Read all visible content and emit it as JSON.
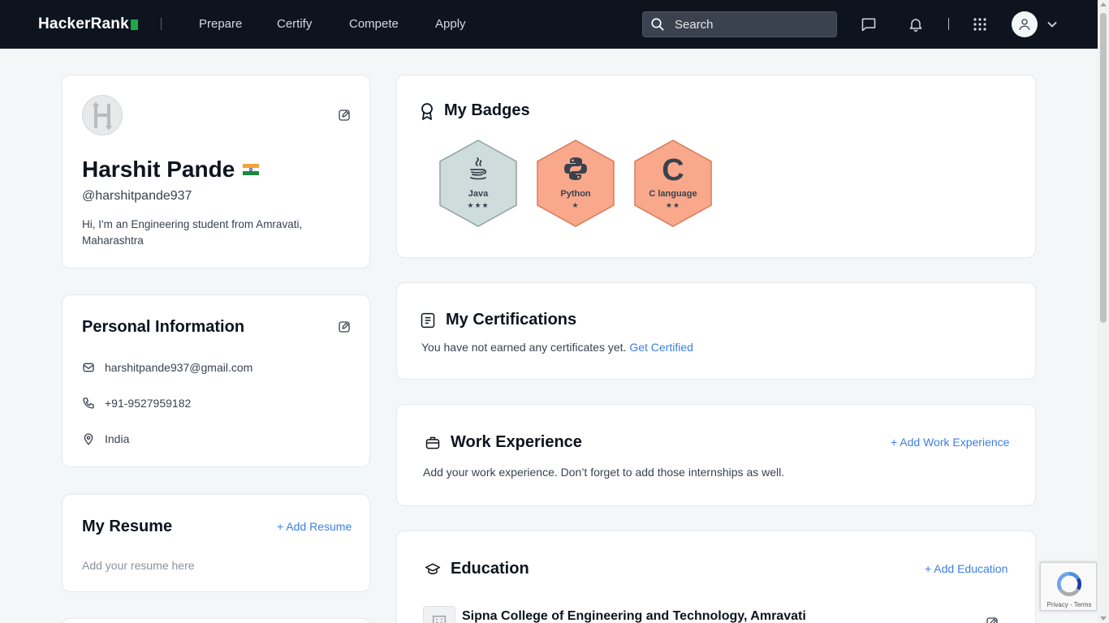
{
  "nav": {
    "logo_text": "HackerRank",
    "links": [
      "Prepare",
      "Certify",
      "Compete",
      "Apply"
    ],
    "search_placeholder": "Search"
  },
  "profile": {
    "name": "Harshit Pande",
    "handle": "@harshitpande937",
    "bio": "Hi, I'm an Engineering student from Amravati, Maharashtra"
  },
  "personal_info": {
    "title": "Personal Information",
    "email": "harshitpande937@gmail.com",
    "phone": "+91-9527959182",
    "location": "India"
  },
  "resume": {
    "title": "My Resume",
    "add_label": "+ Add Resume",
    "placeholder_text": "Add your resume here"
  },
  "badges": {
    "title": "My Badges",
    "items": [
      {
        "name": "Java",
        "stars": "★★★",
        "stars_count": 3,
        "color": "#cfdcdc",
        "border": "#8fa3a3",
        "icon": "java-icon"
      },
      {
        "name": "Python",
        "stars": "★",
        "stars_count": 1,
        "color": "#f9a88b",
        "border": "#d77a5b",
        "icon": "python-icon"
      },
      {
        "name": "C language",
        "stars": "★★",
        "stars_count": 2,
        "color": "#f9a88b",
        "border": "#d77a5b",
        "icon": "c-icon",
        "glyph": "C"
      }
    ]
  },
  "certifications": {
    "title": "My Certifications",
    "text": "You have not earned any certificates yet.",
    "link": "Get Certified"
  },
  "work": {
    "title": "Work Experience",
    "add_label": "+ Add Work Experience",
    "text": "Add your work experience. Don’t forget to add those internships as well."
  },
  "education": {
    "title": "Education",
    "add_label": "+ Add Education",
    "school": "Sipna College of Engineering and Technology, Amravati"
  },
  "recaptcha": {
    "text": "Privacy - Terms"
  },
  "colors": {
    "nav_bg": "#0e141e",
    "page_bg": "#f3f7f7",
    "accent_link": "#3d7fe0",
    "brand_green": "#1ba94c"
  }
}
